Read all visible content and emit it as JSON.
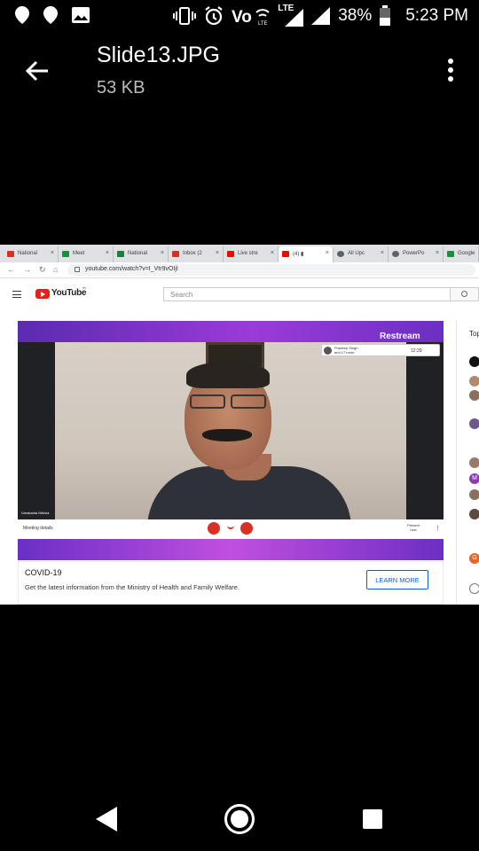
{
  "status_bar": {
    "battery": "38%",
    "time": "5:23 PM",
    "network_label": "LTE",
    "icons": [
      "location-icon",
      "location-icon",
      "image-icon",
      "vibrate-icon",
      "alarm-icon",
      "volte-icon",
      "signal-icon",
      "signal-icon",
      "battery-icon"
    ]
  },
  "app_bar": {
    "title": "Slide13.JPG",
    "subtitle": "53 KB",
    "icons": [
      "back-arrow-icon",
      "more-vert-icon"
    ]
  },
  "screenshot": {
    "browser": {
      "tabs": [
        {
          "label": "National",
          "color": "#d93025"
        },
        {
          "label": "Meet",
          "color": "#1e8e3e"
        },
        {
          "label": "National",
          "color": "#188038"
        },
        {
          "label": "Inbox (2",
          "color": "#d93025"
        },
        {
          "label": "Live stre",
          "color": "#ff0000"
        },
        {
          "label": "(4) ▮",
          "color": "#ff0000"
        },
        {
          "label": "All Upc",
          "color": "#5f6368"
        },
        {
          "label": "PowerPo",
          "color": "#5f6368"
        },
        {
          "label": "Google",
          "color": "#1e8e3e"
        }
      ],
      "url": "youtube.com/watch?v=I_Vtr9vOIjI"
    },
    "youtube": {
      "logo_text": "YouTube",
      "logo_region": "IN",
      "search_placeholder": "Search",
      "video": {
        "overlay_brand": "Restream",
        "tile_name": "Pradeep Singh",
        "tile_sub": "and 17 more",
        "tile_time": "12:29",
        "name_tag": "Umakanta Mishra",
        "meeting_details": "Meeting details",
        "present_label": "Present now"
      },
      "covid_banner": {
        "title": "COVID-19",
        "description": "Get the latest information from the Ministry of Health and Family Welfare.",
        "button": "LEARN MORE"
      },
      "side_panel": {
        "header": "Top"
      }
    }
  },
  "colors": {
    "background": "#000000",
    "youtube_red": "#e62117",
    "restream_purple": "#7a34cc",
    "link_blue": "#065fd4"
  }
}
